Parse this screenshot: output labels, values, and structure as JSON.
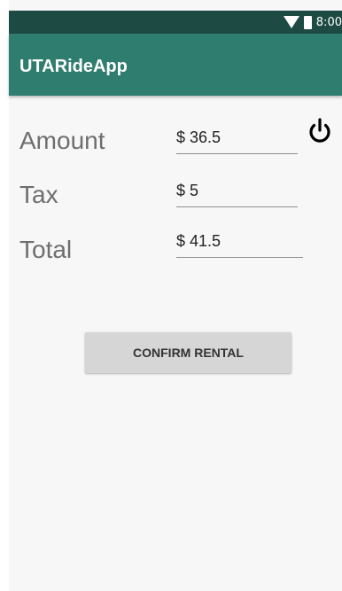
{
  "status_bar": {
    "time": "8:00",
    "icons": [
      "wifi-icon",
      "battery-icon"
    ]
  },
  "app_bar": {
    "title": "UTARideApp"
  },
  "form": {
    "amount_label": "Amount",
    "amount_value": "$ 36.5",
    "tax_label": "Tax",
    "tax_value": "$ 5",
    "total_label": "Total",
    "total_value": "$ 41.5"
  },
  "actions": {
    "confirm_label": "CONFIRM RENTAL",
    "power_icon": "power-icon"
  },
  "colors": {
    "status_bar": "#1d4a43",
    "app_bar": "#2f7d6f",
    "button": "#d6d6d6"
  }
}
